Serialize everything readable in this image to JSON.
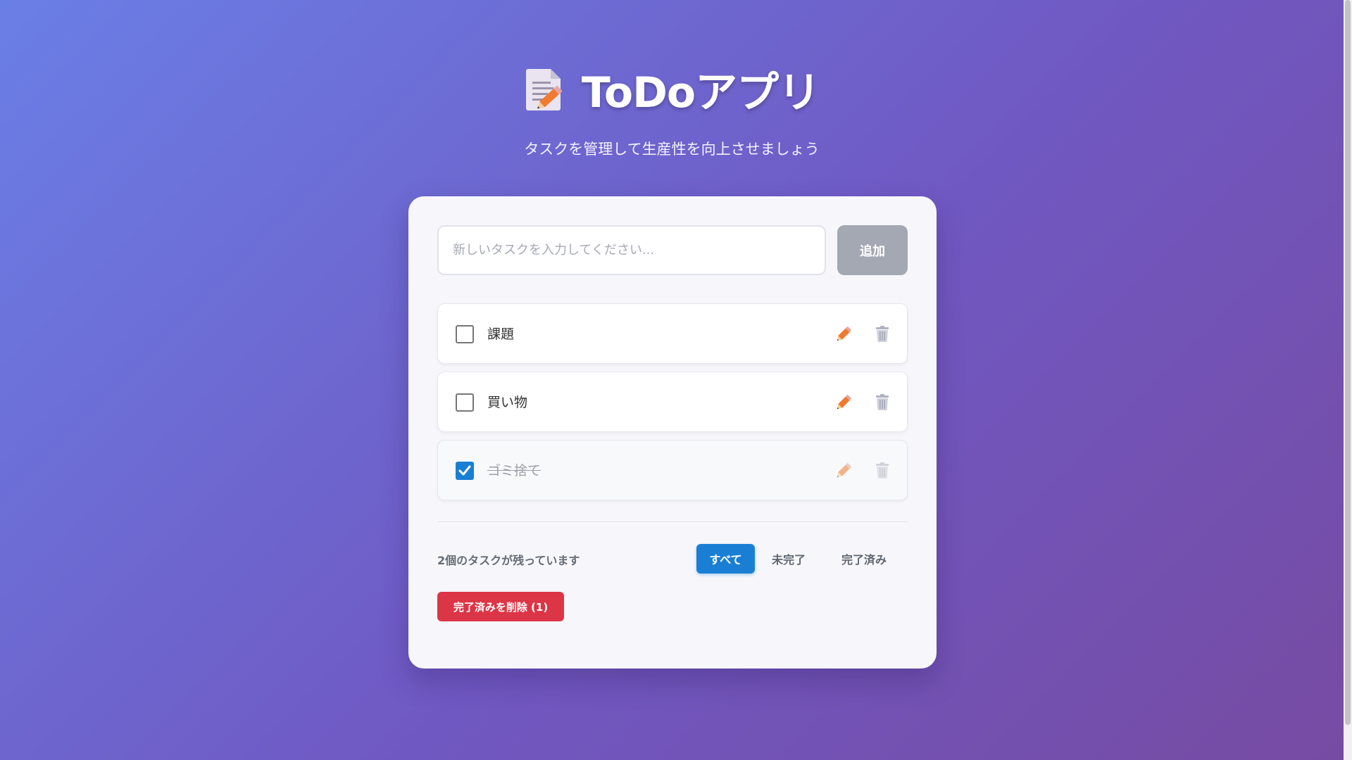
{
  "header": {
    "title": "ToDoアプリ",
    "subtitle": "タスクを管理して生産性を向上させましょう",
    "icon": "memo-icon"
  },
  "input": {
    "placeholder": "新しいタスクを入力してください...",
    "value": ""
  },
  "add_button": {
    "label": "追加"
  },
  "tasks": [
    {
      "label": "課題",
      "completed": false
    },
    {
      "label": "買い物",
      "completed": false
    },
    {
      "label": "ゴミ捨て",
      "completed": true
    }
  ],
  "icons": {
    "edit": "pencil-icon",
    "delete": "trash-icon",
    "check": "checkmark-icon"
  },
  "footer": {
    "remaining": "2個のタスクが残っています",
    "filters": {
      "all": "すべて",
      "active": "未完了",
      "completed": "完了済み",
      "selected": "all"
    },
    "clear_completed": "完了済みを削除 (1)"
  },
  "colors": {
    "primary": "#1a7fd4",
    "danger": "#dc3545",
    "add_button_disabled": "#a3a8b3",
    "background_start": "#6a7fe6",
    "background_end": "#764ba2"
  }
}
